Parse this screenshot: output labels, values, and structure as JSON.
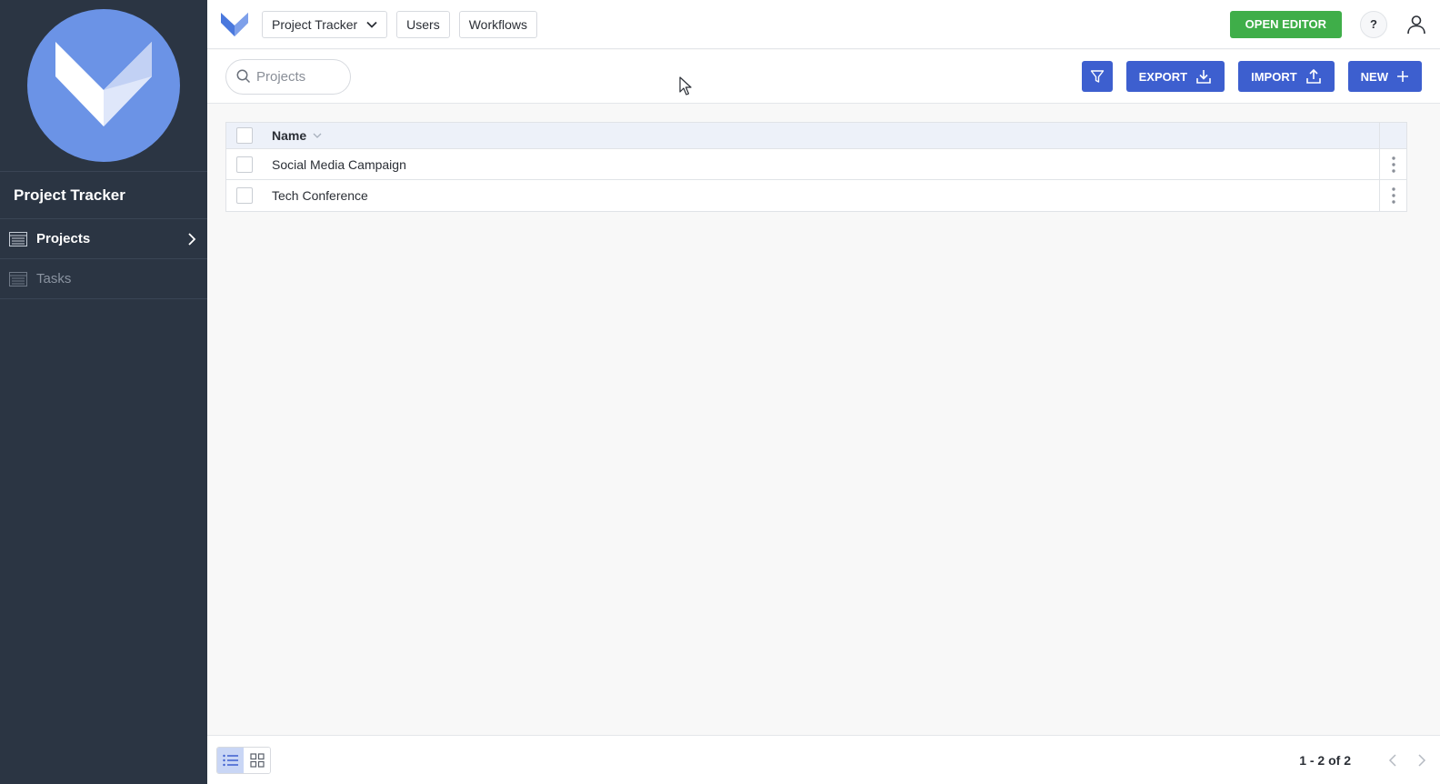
{
  "sidebar": {
    "app_title": "Project Tracker",
    "items": [
      {
        "label": "Projects",
        "active": true,
        "icon": "table-icon"
      },
      {
        "label": "Tasks",
        "active": false,
        "icon": "table-icon"
      }
    ]
  },
  "topbar": {
    "app_select_label": "Project Tracker",
    "users_label": "Users",
    "workflows_label": "Workflows",
    "open_editor_label": "OPEN EDITOR",
    "help_label": "?"
  },
  "toolbar": {
    "search_placeholder": "Projects",
    "export_label": "EXPORT",
    "import_label": "IMPORT",
    "new_label": "NEW"
  },
  "table": {
    "columns": [
      {
        "label": "Name"
      }
    ],
    "rows": [
      {
        "name": "Social Media Campaign"
      },
      {
        "name": "Tech Conference"
      }
    ]
  },
  "footer": {
    "pager_text": "1 - 2 of 2"
  },
  "colors": {
    "sidebar_bg": "#2b3543",
    "accent_blue": "#3d5fcf",
    "open_editor_green": "#3fae49",
    "logo_blue": "#6b93e6"
  }
}
